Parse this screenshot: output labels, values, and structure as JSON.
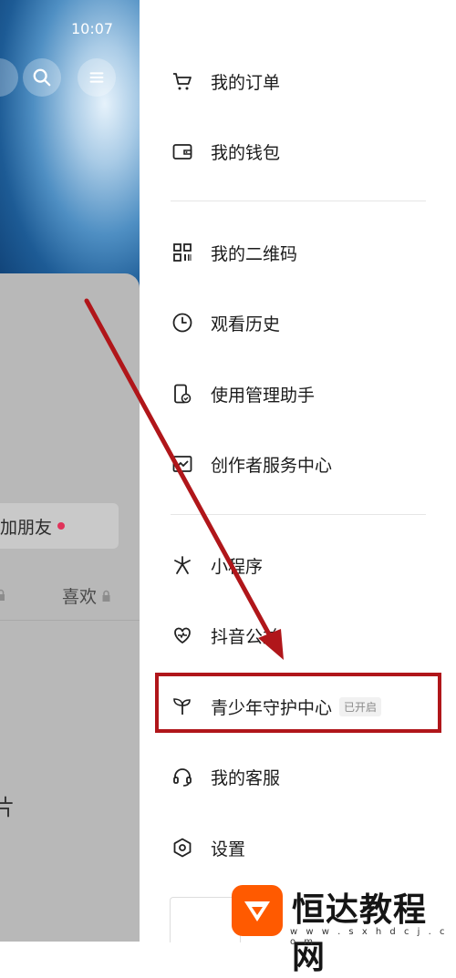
{
  "status_bar": {
    "time": "10:07"
  },
  "left_panel": {
    "add_friend_label": "加朋友",
    "likes_label": "喜欢",
    "fragment_char": "片"
  },
  "menu": {
    "group1": [
      {
        "label": "我的订单",
        "icon": "cart-icon"
      },
      {
        "label": "我的钱包",
        "icon": "wallet-icon"
      }
    ],
    "group2": [
      {
        "label": "我的二维码",
        "icon": "qrcode-icon"
      },
      {
        "label": "观看历史",
        "icon": "clock-icon"
      },
      {
        "label": "使用管理助手",
        "icon": "phone-check-icon"
      },
      {
        "label": "创作者服务中心",
        "icon": "chart-icon"
      }
    ],
    "group3": [
      {
        "label": "小程序",
        "icon": "asterisk-icon"
      },
      {
        "label": "抖音公益",
        "icon": "heart-hand-icon"
      },
      {
        "label": "青少年守护中心",
        "icon": "sprout-icon",
        "badge": "已开启"
      },
      {
        "label": "我的客服",
        "icon": "headset-icon"
      },
      {
        "label": "设置",
        "icon": "settings-icon"
      }
    ]
  },
  "colors": {
    "highlight": "#b0161a",
    "arrow": "#b0161a",
    "watermark_brand": "#ff5a00"
  },
  "watermark": {
    "text": "恒达教程网",
    "url": "w w w . s x h d c j . c o m"
  }
}
